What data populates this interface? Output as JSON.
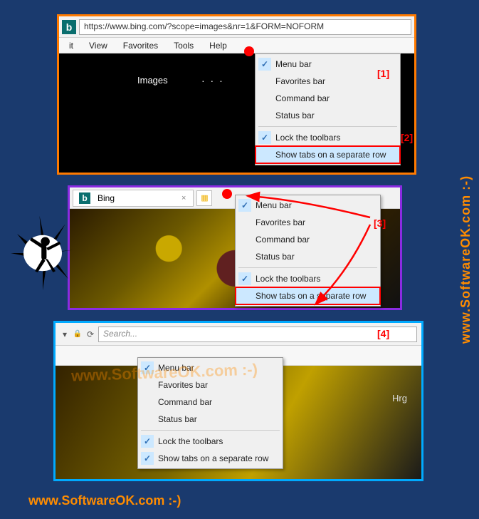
{
  "watermark": "www.SoftwareOK.com :-)",
  "panel1": {
    "url": "https://www.bing.com/?scope=images&nr=1&FORM=NOFORM",
    "menubar": [
      "it",
      "View",
      "Favorites",
      "Tools",
      "Help"
    ],
    "content_label": "Images",
    "dots": "· · ·"
  },
  "context_menu": {
    "items": [
      {
        "label": "Menu bar",
        "checked": true
      },
      {
        "label": "Favorites bar",
        "checked": false
      },
      {
        "label": "Command bar",
        "checked": false
      },
      {
        "label": "Status bar",
        "checked": false
      }
    ],
    "lock_label": "Lock the toolbars",
    "separate_row_label": "Show tabs on a separate row"
  },
  "panel2": {
    "tab_title": "Bing"
  },
  "panel3": {
    "search_placeholder": "Search...",
    "hrg": "Hrg"
  },
  "annotations": {
    "a1": "[1]",
    "a2": "[2]",
    "a3": "[3]",
    "a4": "[4]"
  }
}
